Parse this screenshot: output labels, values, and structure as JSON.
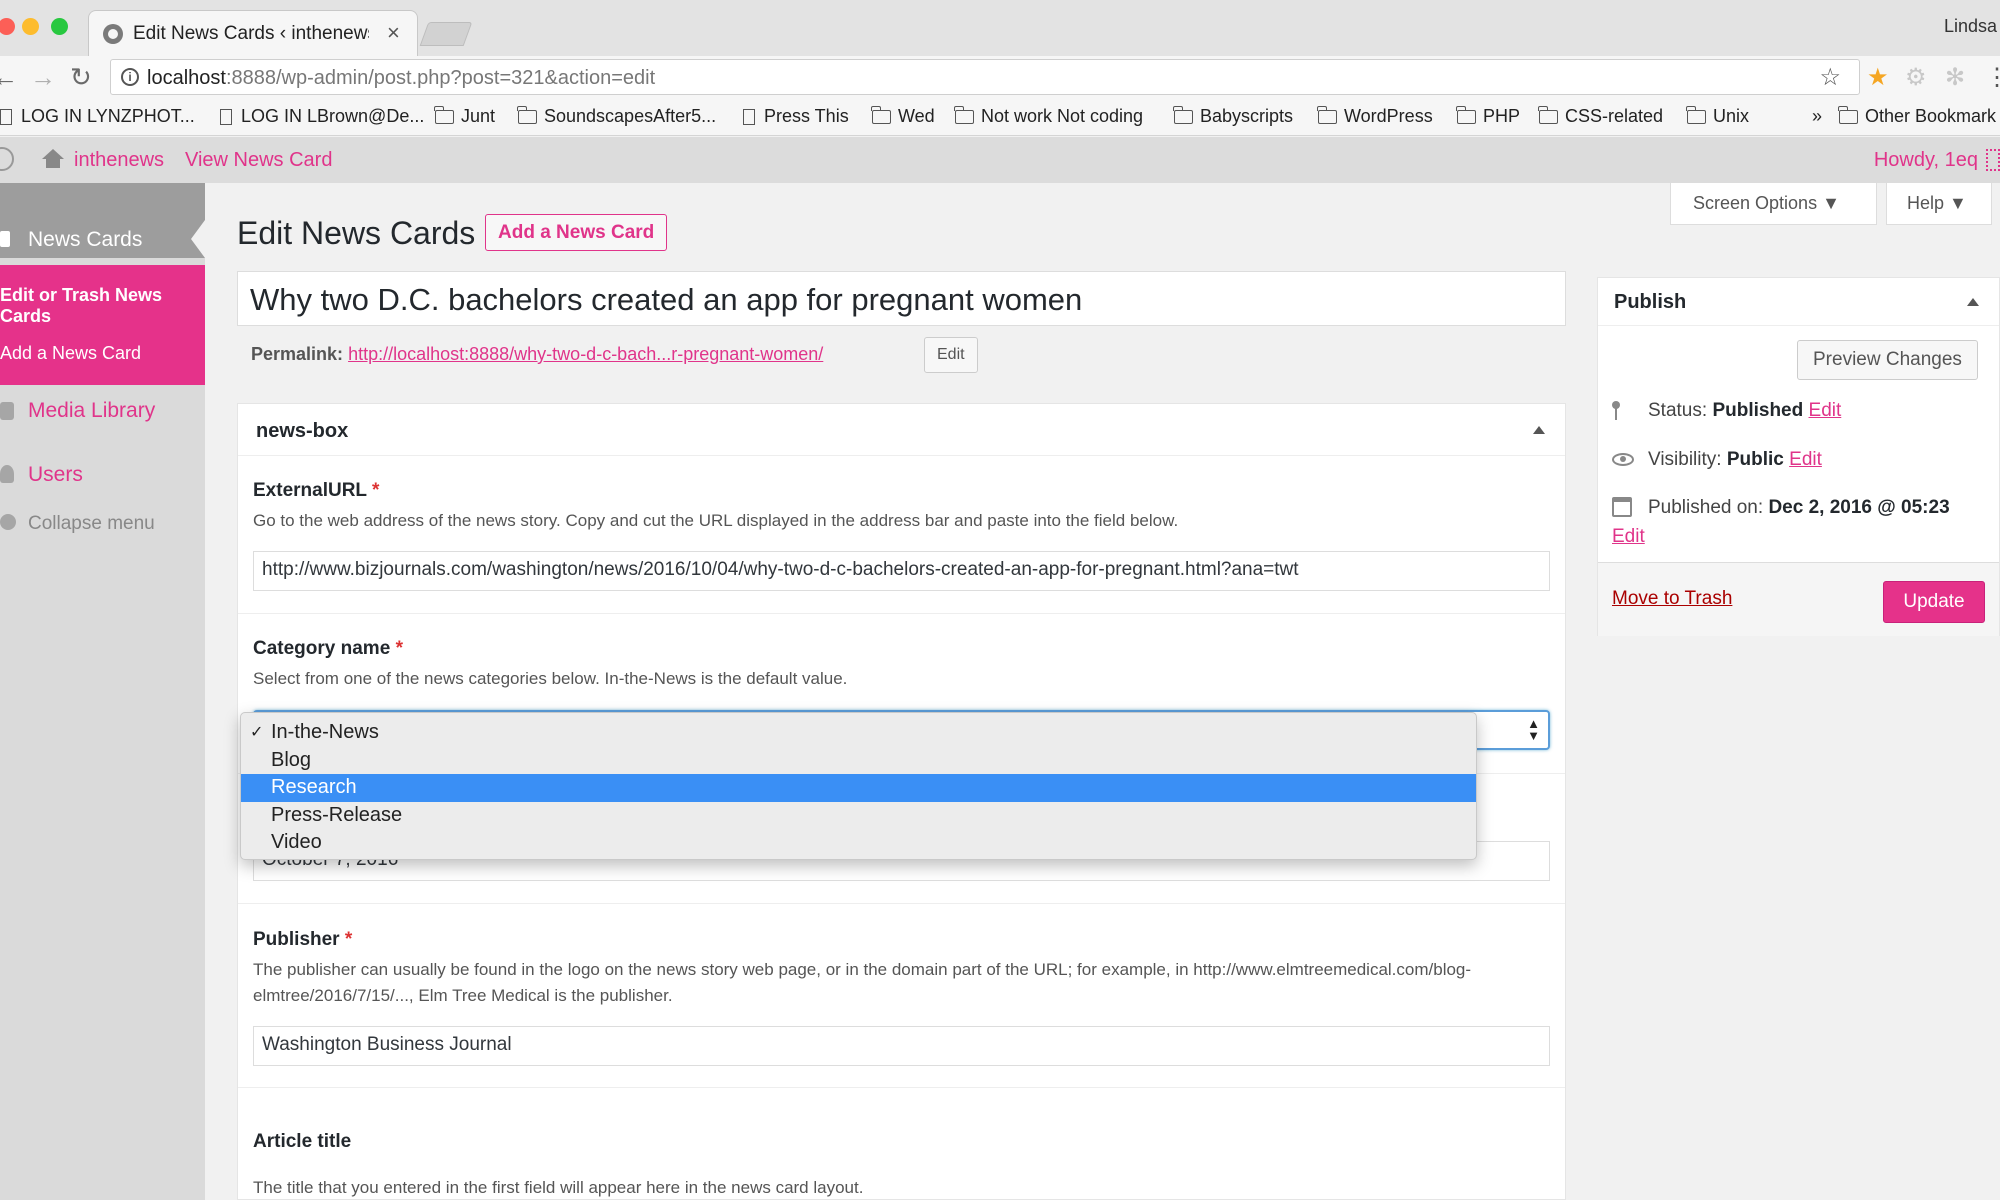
{
  "browser": {
    "tab_title": "Edit News Cards ‹ inthenews —",
    "tab_close": "×",
    "profile": "Lindsa",
    "url_host": "localhost",
    "url_rest": ":8888/wp-admin/post.php?post=321&action=edit",
    "bookmarks": [
      "LOG IN LYNZPHOT...",
      "LOG IN LBrown@De...",
      "Junt",
      "SoundscapesAfter5...",
      "Press This",
      "Wed",
      "Not work Not coding",
      "Babyscripts",
      "WordPress",
      "PHP",
      "CSS-related",
      "Unix"
    ],
    "bookmarks_overflow": "»",
    "other_bookmarks": "Other Bookmark"
  },
  "adminbar": {
    "site_name": "inthenews",
    "view_link": "View News Card",
    "howdy": "Howdy, 1eq"
  },
  "sidebar": {
    "current": "News Cards",
    "submenu": [
      "Edit or Trash News Cards",
      "Add a News Card"
    ],
    "items": [
      "Media Library",
      "Users"
    ],
    "collapse": "Collapse menu"
  },
  "header": {
    "title": "Edit News Cards",
    "add_new": "Add a News Card",
    "screen_options": "Screen Options ▼",
    "help": "Help ▼"
  },
  "post": {
    "title": "Why two D.C. bachelors created an app for pregnant women",
    "permalink_label": "Permalink:",
    "permalink_url": "http://localhost:8888/why-two-d-c-bach...r-pregnant-women/",
    "permalink_edit": "Edit"
  },
  "newsbox": {
    "title": "news-box",
    "required_mark": "*",
    "external_url": {
      "label": "ExternalURL",
      "desc": "Go to the web address of the news story. Copy and cut the URL displayed in the address bar and paste into the field below.",
      "value": "http://www.bizjournals.com/washington/news/2016/10/04/why-two-d-c-bachelors-created-an-app-for-pregnant.html?ana=twt"
    },
    "category": {
      "label": "Category name",
      "desc": "Select from one of the news categories below. In-the-News is the default value.",
      "options": [
        "In-the-News",
        "Blog",
        "Research",
        "Press-Release",
        "Video"
      ],
      "checked": "In-the-News",
      "highlighted": "Research",
      "checkmark": "✓"
    },
    "date": {
      "value": "October 7, 2016"
    },
    "publisher": {
      "label": "Publisher",
      "desc": "The publisher can usually be found in the logo on the news story web page, or in the domain part of the URL; for example, in http://www.elmtreemedical.com/blog-elmtree/2016/7/15/..., Elm Tree Medical is the publisher.",
      "value": "Washington Business Journal"
    },
    "article_title": {
      "label": "Article title",
      "desc": "The title that you entered in the first field will appear here in the news card layout."
    }
  },
  "publish": {
    "title": "Publish",
    "preview": "Preview Changes",
    "status_label": "Status:",
    "status_value": "Published",
    "visibility_label": "Visibility:",
    "visibility_value": "Public",
    "published_label": "Published on:",
    "published_value": "Dec 2, 2016 @ 05:23",
    "edit": "Edit",
    "trash": "Move to Trash",
    "update": "Update"
  },
  "colors": {
    "accent": "#e5328a",
    "link": "#e0348a",
    "trash": "#aa0000",
    "select_highlight": "#3a8ff5"
  }
}
